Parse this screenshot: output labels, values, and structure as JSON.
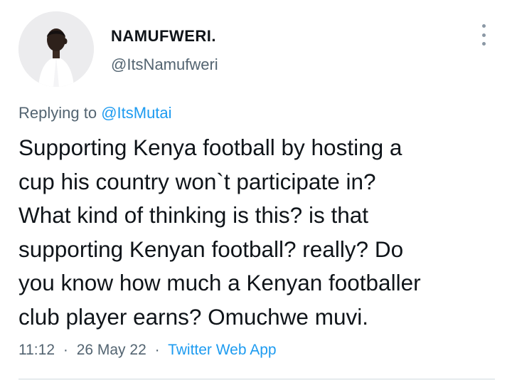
{
  "author": {
    "display_name": "NAMUFWERI.",
    "handle": "@ItsNamufweri"
  },
  "reply": {
    "prefix": "Replying to ",
    "to_handle": "@ItsMutai"
  },
  "tweet": {
    "text": "Supporting Kenya football by hosting a\ncup his country won`t participate in?\nWhat kind of thinking is this?  is that\nsupporting Kenyan football? really? Do\nyou know how much a Kenyan footballer\nclub player earns? Omuchwe muvi.",
    "time": "11:12",
    "date": "26 May 22",
    "source": "Twitter Web App",
    "separator": "·"
  },
  "icons": {
    "more": "more-vertical-icon",
    "avatar": "avatar"
  },
  "colors": {
    "link": "#1d9bf0",
    "secondary_text": "#536471",
    "primary_text": "#0f1419"
  }
}
